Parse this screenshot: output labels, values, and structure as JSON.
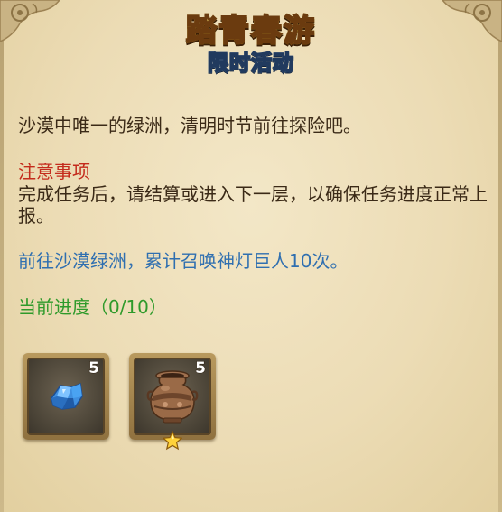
{
  "event": {
    "title": "踏青春游",
    "subtitle": "限时活动"
  },
  "description": "沙漠中唯一的绿洲，清明时节前往探险吧。",
  "notice": {
    "title": "注意事项",
    "body": "完成任务后，请结算或进入下一层，以确保任务进度正常上报。"
  },
  "objective": "前往沙漠绿洲，累计召唤神灯巨人10次。",
  "progress": {
    "text": "当前进度（0/10）",
    "current": 0,
    "total": 10
  },
  "rewards": [
    {
      "icon": "blue-crystal-icon",
      "count": "5"
    },
    {
      "icon": "bronze-urn-icon",
      "count": "5",
      "star": true
    }
  ],
  "colors": {
    "notice": "#c42b1c",
    "objective": "#2f6fb0",
    "progress": "#2e9a2a",
    "title": "#ffe24a",
    "subtitle": "#bfe4ff"
  }
}
